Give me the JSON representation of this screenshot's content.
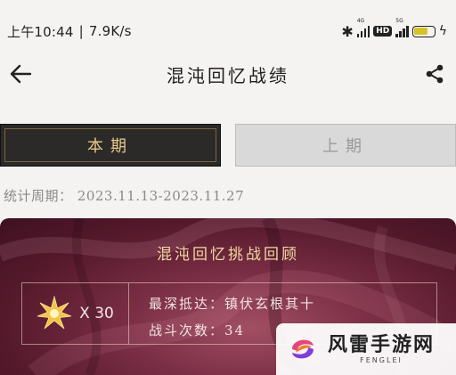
{
  "status_bar": {
    "time": "上午10:44",
    "network_speed": "7.9K/s",
    "signal_1_tag": "4G",
    "signal_2_tag": "5G",
    "hd_label": "HD"
  },
  "header": {
    "title": "混沌回忆战绩",
    "back_icon": "arrow-left-icon",
    "share_icon": "share-icon"
  },
  "tabs": [
    {
      "label": "本期",
      "active": true
    },
    {
      "label": "上期",
      "active": false
    }
  ],
  "period": {
    "label": "统计周期：",
    "range": "2023.11.13-2023.11.27"
  },
  "review": {
    "title": "混沌回忆挑战回顾",
    "star_icon": "star-icon",
    "star_count": "X 30",
    "deepest_label": "最深抵达：",
    "deepest_value": "镇伏玄根其十",
    "battles_label": "战斗次数：",
    "battles_value": "34"
  },
  "watermark": {
    "name": "风雷手游网",
    "sub": "FENGLEI"
  },
  "colors": {
    "tab_active_bg": "#2b2a28",
    "tab_active_text": "#e9c98a",
    "tab_inactive_bg": "#d9d9d9",
    "card_bg": "#6e2740",
    "star": "#f4c542"
  }
}
